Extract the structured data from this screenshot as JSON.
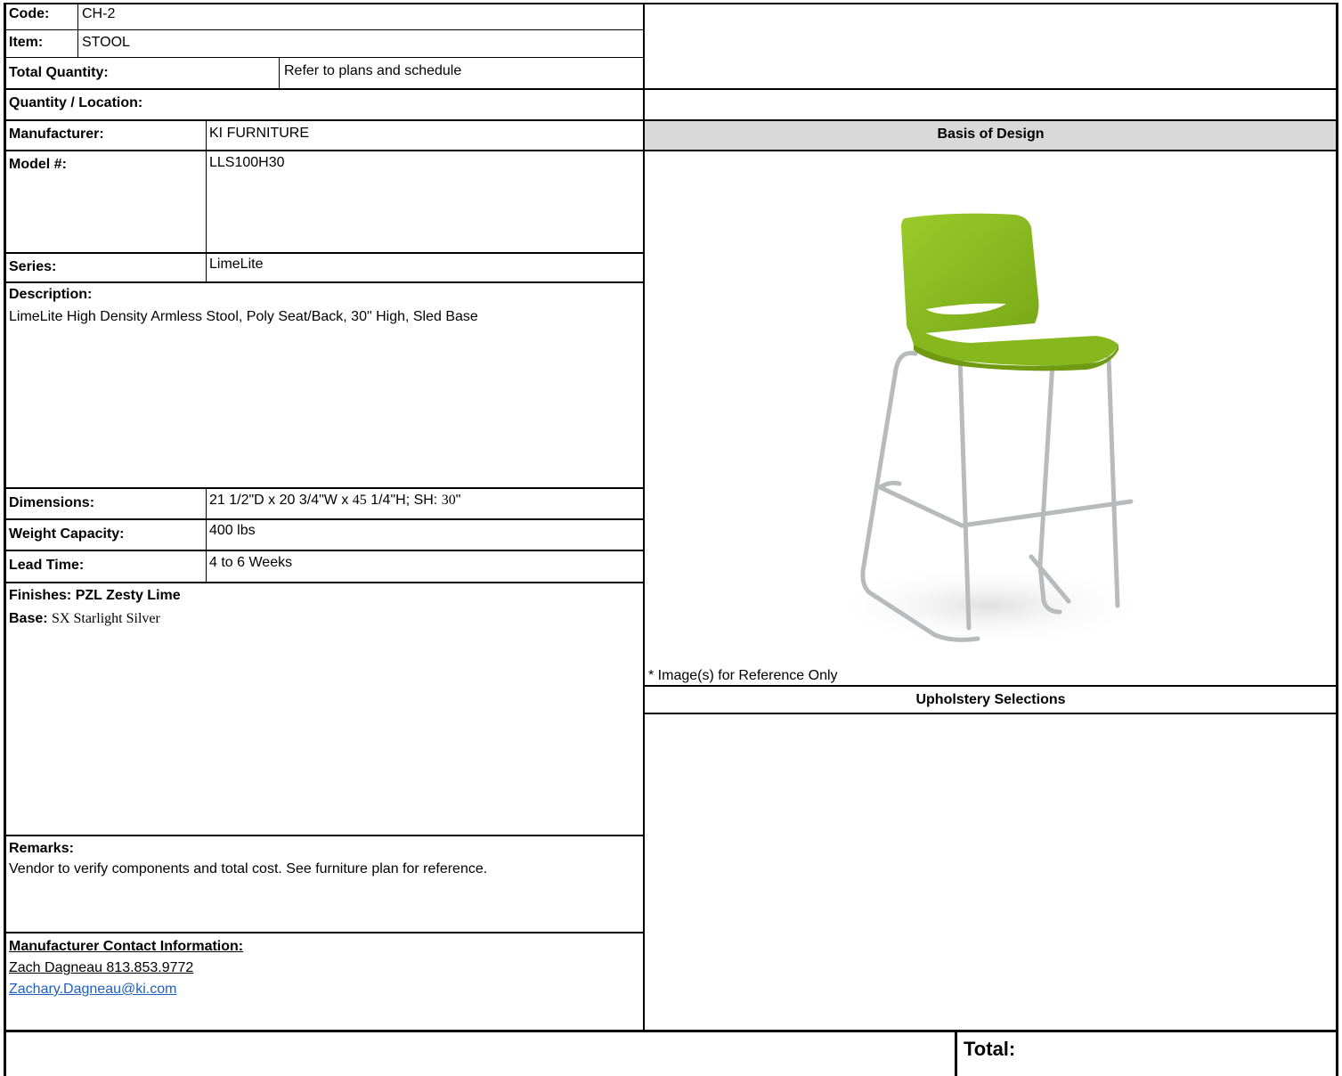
{
  "code": {
    "label": "Code:",
    "value": "CH-2"
  },
  "item": {
    "label": "Item:",
    "value": "STOOL"
  },
  "total_quantity": {
    "label": "Total Quantity:",
    "value": "Refer to plans and schedule"
  },
  "quantity_location": {
    "label": "Quantity / Location:"
  },
  "manufacturer": {
    "label": "Manufacturer:",
    "value": "KI FURNITURE"
  },
  "model": {
    "label": "Model #:",
    "value": "LLS100H30"
  },
  "series": {
    "label": "Series:",
    "value": "LimeLite"
  },
  "description": {
    "label": "Description:",
    "value": "LimeLite High Density Armless Stool, Poly Seat/Back, 30\" High, Sled Base"
  },
  "dimensions": {
    "label": "Dimensions:",
    "value_pre": "21 1/2\"D x 20 3/4\"W x ",
    "value_serif1": "45",
    "value_mid": " 1/4\"H; SH: ",
    "value_serif2": "30",
    "value_post": "\""
  },
  "weight_capacity": {
    "label": "Weight Capacity:",
    "value": "400 lbs"
  },
  "lead_time": {
    "label": "Lead Time:",
    "value": "4 to 6 Weeks"
  },
  "finishes": {
    "label": "Finishes:",
    "value": "PZL Zesty Lime",
    "base_label": "Base:",
    "base_value": "SX Starlight Silver"
  },
  "remarks": {
    "label": "Remarks:",
    "value": "Vendor to verify components and total cost. See furniture plan for reference."
  },
  "contact": {
    "label": "Manufacturer Contact Information:",
    "name_phone": "Zach Dagneau 813.853.9772",
    "email": "Zachary.Dagneau@ki.com"
  },
  "basis_of_design": {
    "header": "Basis of Design",
    "image_note": "* Image(s) for Reference Only"
  },
  "upholstery": {
    "header": "Upholstery Selections"
  },
  "total": {
    "label": "Total:"
  },
  "colors": {
    "seat": "#8cbf1f",
    "seat_shadow": "#6f9a12",
    "frame": "#b8babb",
    "header_bg": "#d9d9d9"
  }
}
